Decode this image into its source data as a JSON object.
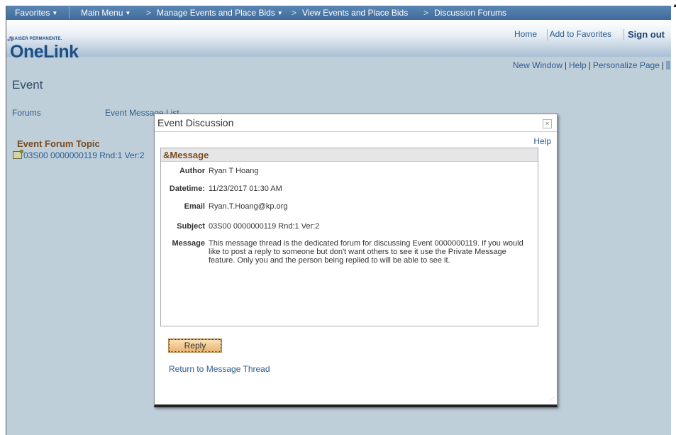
{
  "navbar": {
    "favorites": "Favorites",
    "main_menu": "Main Menu",
    "breadcrumbs": [
      "Manage Events and Place Bids",
      "View Events and Place Bids",
      "Discussion Forums"
    ]
  },
  "header": {
    "brand_small": "KAISER PERMANENTE.",
    "logo": "OneLink",
    "home": "Home",
    "add_to_favorites": "Add to Favorites",
    "sign_out": "Sign out"
  },
  "page_links": {
    "new_window": "New Window",
    "help": "Help",
    "personalize": "Personalize Page"
  },
  "page": {
    "title": "Event",
    "tab_forums": "Forums",
    "tab_event_message_list": "Event Message List",
    "topic_heading": "Event Forum Topic",
    "topic_item": "03S00 0000000119 Rnd:1 Ver:2"
  },
  "modal": {
    "title": "Event Discussion",
    "close": "×",
    "help": "Help",
    "section_label": "&Message",
    "fields": {
      "author_label": "Author",
      "author": "Ryan T Hoang",
      "datetime_label": "Datetime:",
      "datetime": "11/23/2017 01:30 AM",
      "email_label": "Email",
      "email": "Ryan.T.Hoang@kp.org",
      "subject_label": "Subject",
      "subject": "03S00 0000000119 Rnd:1 Ver:2",
      "message_label": "Message",
      "message": "This message thread is the dedicated forum for discussing Event 0000000119.  If you would like to post a reply to someone but don't want others to see it use the Private Message feature.  Only you and the person being replied to will be able to see it."
    },
    "reply_button": "Reply",
    "return_link": "Return to Message Thread"
  },
  "colors": {
    "nav_bg": "#4a78a8",
    "page_bg": "#bfcfda",
    "link": "#2b5c8f",
    "section_label": "#7a4a1e"
  }
}
